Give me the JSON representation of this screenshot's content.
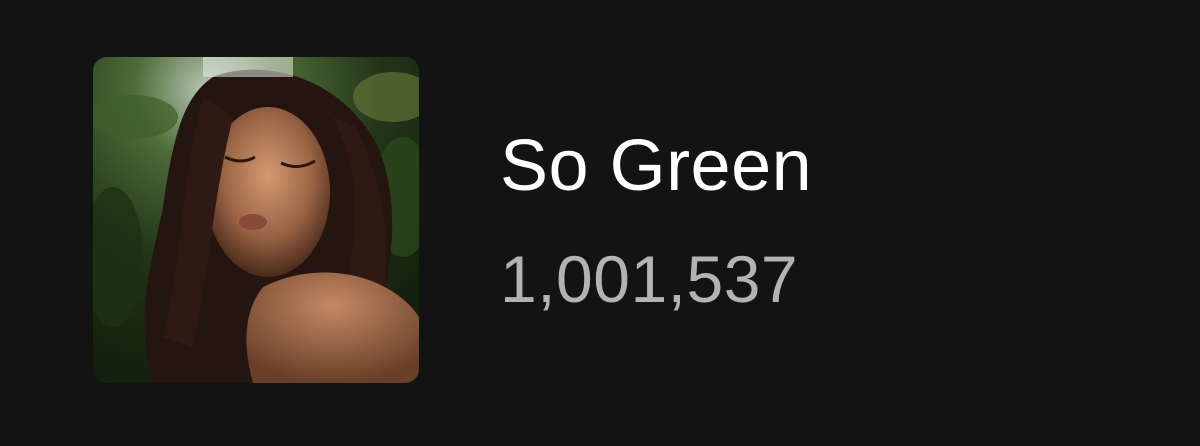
{
  "track": {
    "title": "So Green",
    "play_count": "1,001,537",
    "cover_art": "portrait photo of a woman with closed eyes and dark wavy hair against green foliage"
  },
  "colors": {
    "background": "#131313",
    "title_text": "#ffffff",
    "count_text": "#b3b3b3"
  }
}
